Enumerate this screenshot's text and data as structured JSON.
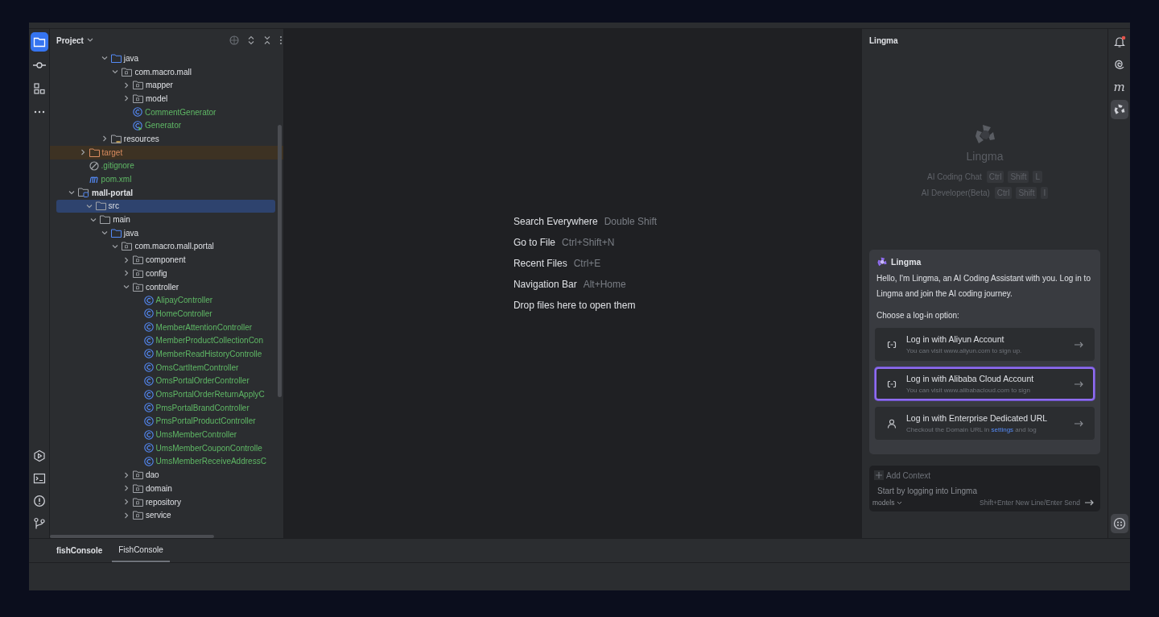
{
  "left_toolbar": {
    "top": [
      {
        "kind": "project",
        "selected": true
      },
      {
        "kind": "commit",
        "selected": false
      },
      {
        "kind": "structure",
        "selected": false
      },
      {
        "kind": "more",
        "selected": false
      }
    ],
    "bottom": [
      {
        "kind": "services"
      },
      {
        "kind": "terminal"
      },
      {
        "kind": "problems"
      },
      {
        "kind": "git"
      }
    ]
  },
  "project_panel": {
    "title": "Project",
    "tree": [
      {
        "children": [
          {
            "children": [
              {
                "children": [
                  {
                    "label": "java",
                    "kind": "source-folder",
                    "expanded": true,
                    "selected": false,
                    "children": [
                      {
                        "label": "com.macro.mall",
                        "kind": "package",
                        "expanded": true,
                        "selected": false,
                        "children": [
                          {
                            "label": "mapper",
                            "kind": "package",
                            "expanded": false,
                            "selected": false
                          },
                          {
                            "label": "model",
                            "kind": "package",
                            "expanded": false,
                            "selected": false
                          },
                          {
                            "label": "CommentGenerator",
                            "kind": "class",
                            "selected": false
                          },
                          {
                            "label": "Generator",
                            "kind": "runnable-class",
                            "selected": false
                          }
                        ]
                      }
                    ]
                  },
                  {
                    "label": "resources",
                    "kind": "resources-folder",
                    "expanded": false,
                    "selected": false
                  }
                ]
              }
            ]
          },
          {
            "label": "target",
            "kind": "excluded-folder",
            "expanded": false,
            "selected": false
          },
          {
            "label": ".gitignore",
            "kind": "ignore-file",
            "selected": false
          },
          {
            "label": "pom.xml",
            "kind": "maven-file",
            "selected": false
          }
        ]
      },
      {
        "label": "mall-portal",
        "kind": "module",
        "expanded": true,
        "selected": false,
        "children": [
          {
            "label": "src",
            "kind": "folder",
            "expanded": true,
            "selected": true,
            "children": [
              {
                "label": "main",
                "kind": "folder",
                "expanded": true,
                "selected": false,
                "children": [
                  {
                    "label": "java",
                    "kind": "source-folder",
                    "expanded": true,
                    "selected": false,
                    "children": [
                      {
                        "label": "com.macro.mall.portal",
                        "kind": "package",
                        "expanded": true,
                        "selected": false,
                        "children": [
                          {
                            "label": "component",
                            "kind": "package",
                            "expanded": false,
                            "selected": false
                          },
                          {
                            "label": "config",
                            "kind": "package",
                            "expanded": false,
                            "selected": false
                          },
                          {
                            "label": "controller",
                            "kind": "package",
                            "expanded": true,
                            "selected": false,
                            "children": [
                              {
                                "label": "AlipayController",
                                "kind": "class",
                                "selected": false
                              },
                              {
                                "label": "HomeController",
                                "kind": "class",
                                "selected": false
                              },
                              {
                                "label": "MemberAttentionController",
                                "kind": "class",
                                "selected": false
                              },
                              {
                                "label": "MemberProductCollectionCon",
                                "kind": "class",
                                "selected": false
                              },
                              {
                                "label": "MemberReadHistoryControlle",
                                "kind": "class",
                                "selected": false
                              },
                              {
                                "label": "OmsCartItemController",
                                "kind": "class",
                                "selected": false
                              },
                              {
                                "label": "OmsPortalOrderController",
                                "kind": "class",
                                "selected": false
                              },
                              {
                                "label": "OmsPortalOrderReturnApplyC",
                                "kind": "class",
                                "selected": false
                              },
                              {
                                "label": "PmsPortalBrandController",
                                "kind": "class",
                                "selected": false
                              },
                              {
                                "label": "PmsPortalProductController",
                                "kind": "class",
                                "selected": false
                              },
                              {
                                "label": "UmsMemberController",
                                "kind": "class",
                                "selected": false
                              },
                              {
                                "label": "UmsMemberCouponControlle",
                                "kind": "class",
                                "selected": false
                              },
                              {
                                "label": "UmsMemberReceiveAddressC",
                                "kind": "class",
                                "selected": false
                              }
                            ]
                          },
                          {
                            "label": "dao",
                            "kind": "package",
                            "expanded": false,
                            "selected": false
                          },
                          {
                            "label": "domain",
                            "kind": "package",
                            "expanded": false,
                            "selected": false
                          },
                          {
                            "label": "repository",
                            "kind": "package",
                            "expanded": false,
                            "selected": false
                          },
                          {
                            "label": "service",
                            "kind": "package",
                            "expanded": false,
                            "selected": false
                          }
                        ]
                      }
                    ]
                  }
                ]
              }
            ]
          }
        ]
      }
    ]
  },
  "editor_hints": [
    {
      "action": "Search Everywhere",
      "shortcut": "Double Shift"
    },
    {
      "action": "Go to File",
      "shortcut": "Ctrl+Shift+N"
    },
    {
      "action": "Recent Files",
      "shortcut": "Ctrl+E"
    },
    {
      "action": "Navigation Bar",
      "shortcut": "Alt+Home"
    },
    {
      "action": "Drop files here to open them"
    }
  ],
  "lingma": {
    "title": "Lingma",
    "brand": "Lingma",
    "shortcuts": [
      {
        "label": "AI Coding Chat",
        "keys": [
          "Ctrl",
          "Shift",
          "L"
        ]
      },
      {
        "label": "AI Developer(Beta)",
        "keys": [
          "Ctrl",
          "Shift",
          "I"
        ]
      }
    ],
    "login_card": {
      "title": "Lingma",
      "message": "Hello, I'm Lingma, an AI Coding Assistant with you. Log in to Lingma and join the AI coding journey.",
      "prompt": "Choose a log-in option:",
      "options": [
        {
          "kind": "link",
          "title": "Log in with Aliyun Account",
          "subtitle": "You can visit www.aliyun.com to sign up.",
          "selected": false
        },
        {
          "kind": "link",
          "title": "Log in with Alibaba Cloud Account",
          "subtitle": "You can visit www.alibabacloud.com to sign",
          "selected": true
        },
        {
          "kind": "person",
          "title": "Log in with Enterprise Dedicated URL",
          "subtitle": "Checkout the Domain URL in",
          "link": "settings",
          "subtitle_end": "and log",
          "selected": false
        }
      ]
    },
    "input": {
      "add_context": "Add Context",
      "placeholder": "Start by logging into Lingma",
      "models": "models",
      "hint": "Shift+Enter New Line/Enter Send"
    }
  },
  "right_toolbar": {
    "top": [
      {
        "kind": "notifications",
        "badge": true,
        "selected": false
      },
      {
        "kind": "swirl",
        "selected": false
      },
      {
        "kind": "glyph",
        "glyph": "m",
        "selected": false
      },
      {
        "kind": "lingma",
        "selected": true
      }
    ],
    "bottom": [
      {
        "kind": "emoji"
      }
    ]
  },
  "bottom_panel": {
    "title": "fishConsole",
    "tabs": [
      {
        "label": "FishConsole",
        "selected": true
      }
    ]
  }
}
